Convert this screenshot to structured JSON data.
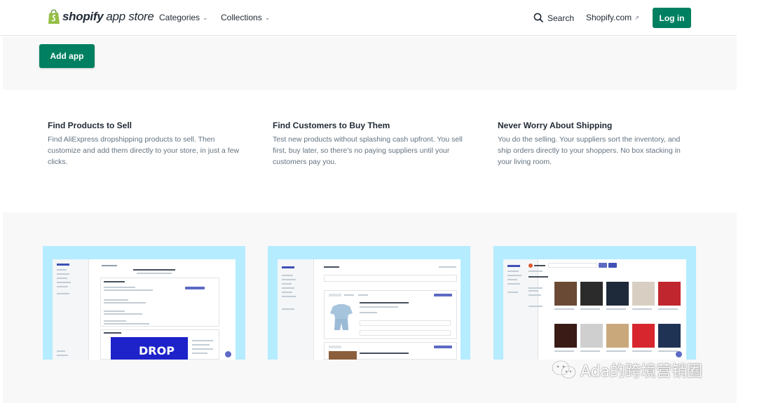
{
  "header": {
    "logo_brand": "shopify",
    "logo_sub": "app store",
    "nav": [
      {
        "label": "Categories"
      },
      {
        "label": "Collections"
      }
    ],
    "search_label": "Search",
    "shopify_link": "Shopify.com",
    "login_label": "Log in"
  },
  "hero": {
    "add_app_label": "Add app"
  },
  "features": [
    {
      "title": "Find Products to Sell",
      "body": "Find AliExpress dropshipping products to sell. Then customize and add them directly to your store, in just a few clicks."
    },
    {
      "title": "Find Customers to Buy Them",
      "body": "Test new products without splashing cash upfront. You sell first, buy later, so there's no paying suppliers until your customers pay you."
    },
    {
      "title": "Never Worry About Shipping",
      "body": "You do the selling. Your suppliers sort the inventory, and ship orders directly to your shoppers. No box stacking in your living room."
    }
  ],
  "screenshots": [
    {
      "name": "dashboard",
      "video_text": "DROP"
    },
    {
      "name": "import-list"
    },
    {
      "name": "product-search"
    }
  ],
  "watermark": "Ada的跨境营销圈",
  "colors": {
    "brand_green": "#008060",
    "screenshot_bg": "#b5ecff",
    "band_gray": "#f8f8f8"
  }
}
